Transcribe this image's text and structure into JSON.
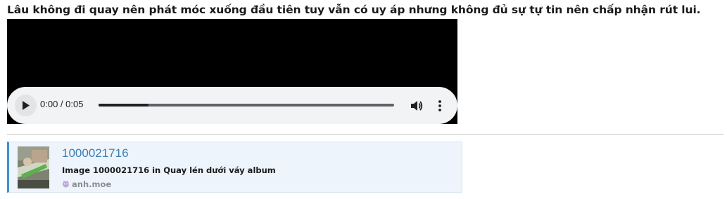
{
  "post": {
    "headline": "Lâu không đi quay nên phát móc xuống đầu tiên tuy vẫn có uy áp nhưng không đủ sự tự tin nên chấp nhận rút lui."
  },
  "media_player": {
    "time_display": "0:00 / 0:05",
    "buffered_fraction": 0.17,
    "play_icon": "play-icon",
    "volume_icon": "volume-icon",
    "more_icon": "more-vertical-icon"
  },
  "link_preview": {
    "title": "1000021716",
    "description": "Image 1000021716 in Quay lén dưới váy album",
    "site_name": "anh.moe",
    "accent_color": "#3d8fd0"
  }
}
